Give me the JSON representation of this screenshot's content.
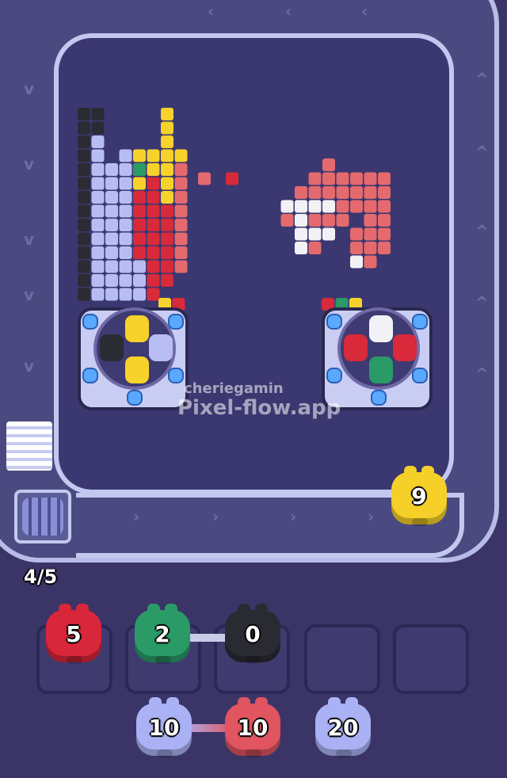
{
  "watermark": {
    "handle": "cheriegamin",
    "site": "Pixel-flow.app"
  },
  "queue_count": "4/5",
  "conveyor_piggy": {
    "number": "9",
    "color": "#f5d028"
  },
  "slots": [
    {
      "number": "5",
      "color": "#d8263a"
    },
    {
      "number": "2",
      "color": "#2a9a67"
    },
    {
      "number": "0",
      "color": "#2a2a33"
    },
    {
      "number": null,
      "color": null
    },
    {
      "number": null,
      "color": null
    }
  ],
  "waiting_row": [
    {
      "number": "10",
      "color": "#aab2f5"
    },
    {
      "number": "10",
      "color": "#e05560"
    },
    {
      "number": "20",
      "color": "#aab2f5"
    }
  ],
  "colors": {
    "black": "#2b2b33",
    "lavender": "#b7bdf2",
    "yellow": "#f6d22a",
    "red": "#d82a3a",
    "salmon": "#e46a6d",
    "white": "#f2f2f6",
    "green": "#2a9a67"
  }
}
